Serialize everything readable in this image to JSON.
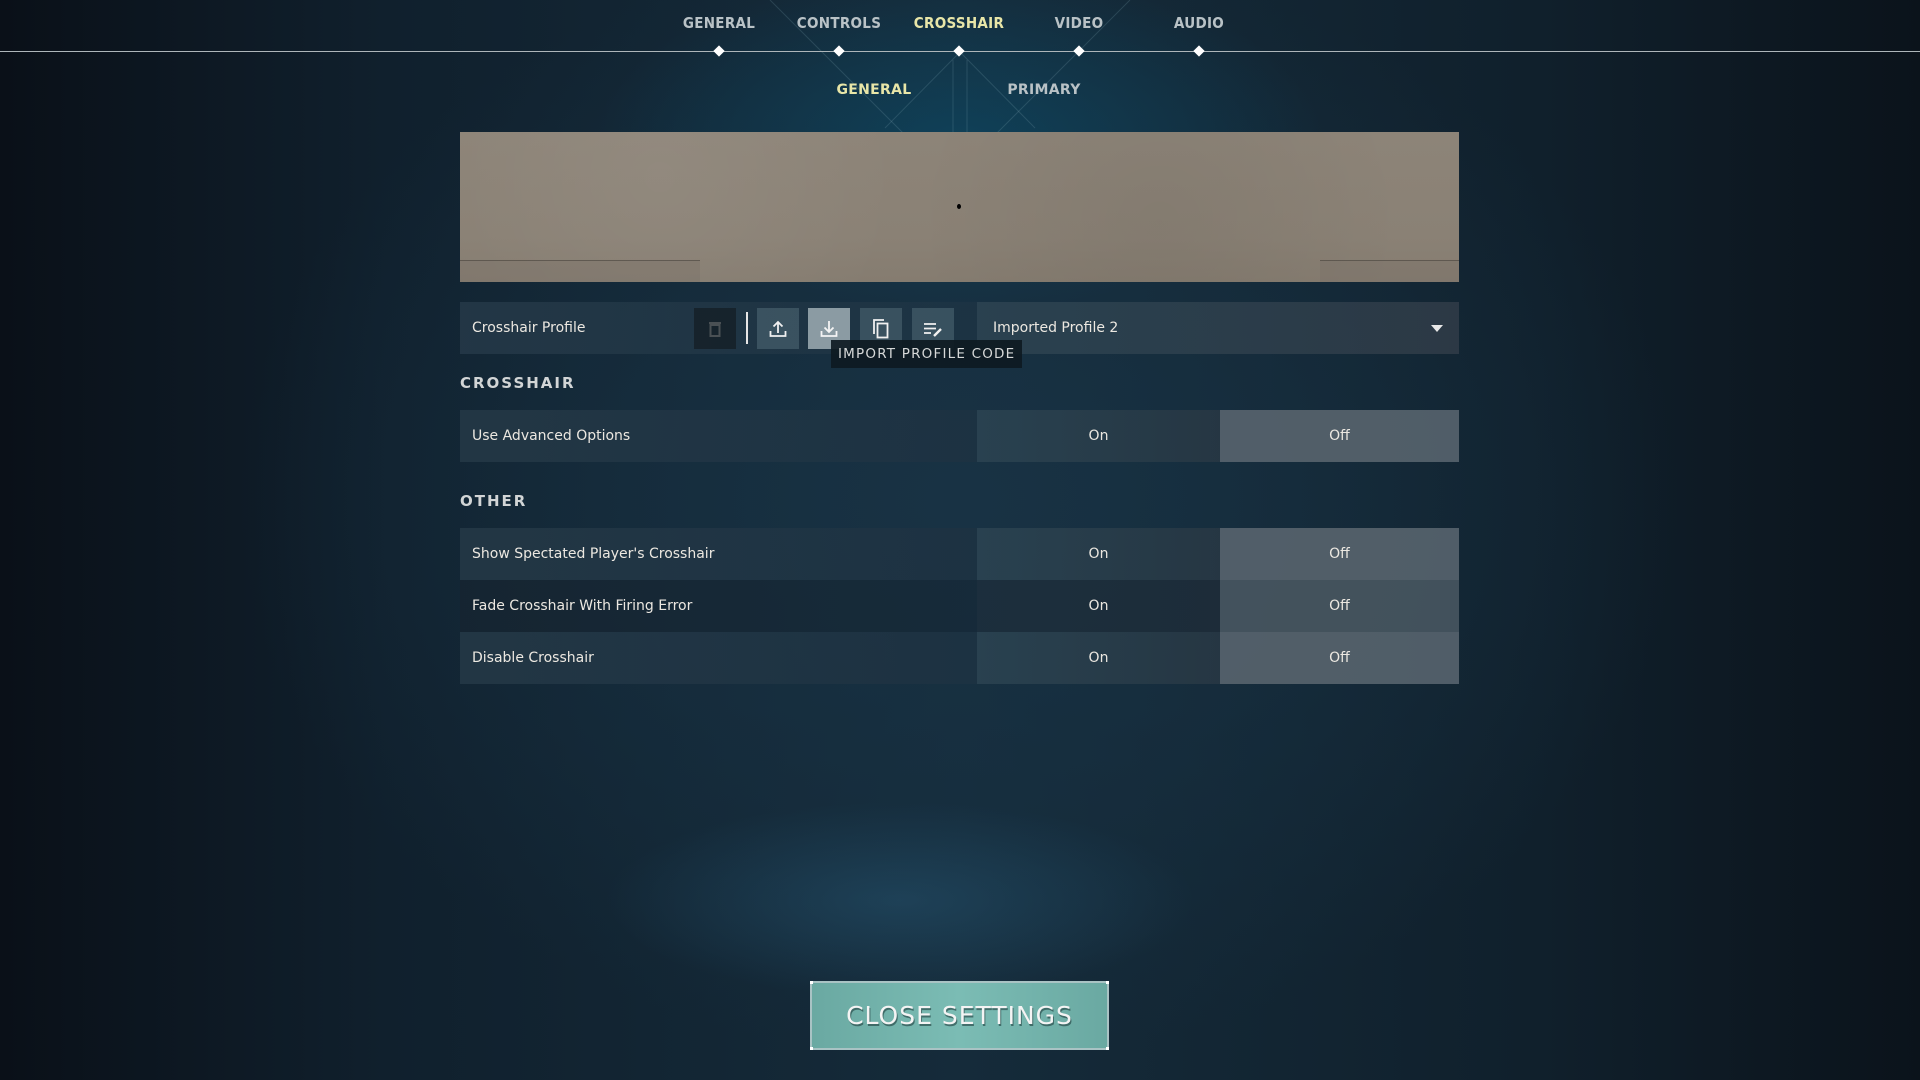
{
  "nav": {
    "tabs": [
      {
        "label": "GENERAL",
        "active": false
      },
      {
        "label": "CONTROLS",
        "active": false
      },
      {
        "label": "CROSSHAIR",
        "active": true
      },
      {
        "label": "VIDEO",
        "active": false
      },
      {
        "label": "AUDIO",
        "active": false
      }
    ],
    "subtabs": [
      {
        "label": "GENERAL",
        "active": true
      },
      {
        "label": "PRIMARY",
        "active": false
      }
    ]
  },
  "profile": {
    "label": "Crosshair Profile",
    "selected": "Imported Profile 2",
    "buttons": [
      {
        "name": "delete-profile",
        "icon": "trash-icon",
        "enabled": false
      },
      {
        "name": "export-profile",
        "icon": "upload-icon",
        "enabled": true
      },
      {
        "name": "import-profile",
        "icon": "download-icon",
        "enabled": true,
        "hovered": true
      },
      {
        "name": "copy-profile",
        "icon": "copy-icon",
        "enabled": true
      },
      {
        "name": "rename-profile",
        "icon": "edit-list-icon",
        "enabled": true
      }
    ],
    "tooltip": "IMPORT PROFILE CODE"
  },
  "sections": [
    {
      "title": "CROSSHAIR",
      "settings": [
        {
          "label": "Use Advanced Options",
          "on_label": "On",
          "off_label": "Off",
          "value": "Off"
        }
      ]
    },
    {
      "title": "OTHER",
      "settings": [
        {
          "label": "Show Spectated Player's Crosshair",
          "on_label": "On",
          "off_label": "Off",
          "value": "Off"
        },
        {
          "label": "Fade Crosshair With Firing Error",
          "on_label": "On",
          "off_label": "Off",
          "value": "Off"
        },
        {
          "label": "Disable Crosshair",
          "on_label": "On",
          "off_label": "Off",
          "value": "Off"
        }
      ]
    }
  ],
  "close_button": "CLOSE SETTINGS",
  "colors": {
    "active_tab": "#e8e6a8",
    "inactive_tab": "#b9c2c6",
    "close_button": "#74b3ab",
    "selected_option": "#58646e"
  }
}
